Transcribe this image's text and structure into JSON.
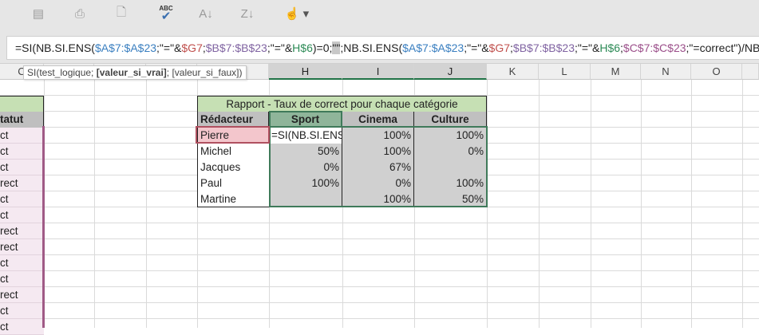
{
  "toolbar": {
    "items": [
      {
        "icon": "form-icon",
        "glyph": "▤"
      },
      {
        "icon": "print-preview-icon",
        "glyph": "⎙"
      },
      {
        "icon": "preview-icon",
        "glyph": "🗋"
      },
      {
        "icon": "spelling-icon",
        "glyph": "✔",
        "label": "ABC"
      },
      {
        "icon": "sort-asc-icon",
        "glyph": "A↓"
      },
      {
        "icon": "sort-desc-icon",
        "glyph": "Z↓"
      },
      {
        "icon": "touch-mode-icon",
        "glyph": "☝"
      }
    ]
  },
  "formula": [
    {
      "t": "=SI(NB.SI.ENS(",
      "c": "#222"
    },
    {
      "t": "$A$7:$A$23",
      "c": "#3a7fc0"
    },
    {
      "t": ";\"=\"&",
      "c": "#222"
    },
    {
      "t": "$G7",
      "c": "#c0504d"
    },
    {
      "t": ";",
      "c": "#222"
    },
    {
      "t": "$B$7:$B$23",
      "c": "#8064a2"
    },
    {
      "t": ";\"=\"&",
      "c": "#222"
    },
    {
      "t": "H$6",
      "c": "#2e8b57"
    },
    {
      "t": ")=0;",
      "c": "#222"
    },
    {
      "t": "\"\"",
      "c": "#222",
      "sel": true
    },
    {
      "t": ";NB.SI.ENS(",
      "c": "#222"
    },
    {
      "t": "$A$7:$A$23",
      "c": "#3a7fc0"
    },
    {
      "t": ";\"=\"&",
      "c": "#222"
    },
    {
      "t": "$G7",
      "c": "#c0504d"
    },
    {
      "t": ";",
      "c": "#222"
    },
    {
      "t": "$B$7:$B$23",
      "c": "#8064a2"
    },
    {
      "t": ";\"=\"&",
      "c": "#222"
    },
    {
      "t": "H$6",
      "c": "#2e8b57"
    },
    {
      "t": ";",
      "c": "#222"
    },
    {
      "t": "$C$7:$C$23",
      "c": "#9b4f8a"
    },
    {
      "t": ";\"=correct\")/NB.SI.ENS(",
      "c": "#222"
    }
  ],
  "tooltip": {
    "prefix": "SI(test_logique; ",
    "bold": "[valeur_si_vrai]",
    "suffix": "; [valeur_si_faux])"
  },
  "columns": [
    "C",
    "H",
    "I",
    "J",
    "K",
    "L",
    "M",
    "N",
    "O"
  ],
  "col_c": {
    "header": "tatut",
    "values": [
      "ct",
      "ct",
      "ct",
      "rect",
      "ct",
      "ct",
      "rect",
      "rect",
      "ct",
      "ct",
      "rect",
      "ct",
      "ct"
    ]
  },
  "report": {
    "title": "Rapport - Taux de correct pour chaque catégorie",
    "headers": [
      "Rédacteur",
      "Sport",
      "Cinema",
      "Culture"
    ],
    "rows": [
      {
        "name": "Pierre",
        "values": [
          "=SI(NB.SI.ENS(",
          "100%",
          "100%"
        ]
      },
      {
        "name": "Michel",
        "values": [
          "50%",
          "100%",
          "0%"
        ]
      },
      {
        "name": "Jacques",
        "values": [
          "0%",
          "67%",
          ""
        ]
      },
      {
        "name": "Paul",
        "values": [
          "100%",
          "0%",
          "100%"
        ]
      },
      {
        "name": "Martine",
        "values": [
          "",
          "100%",
          "50%"
        ]
      }
    ]
  }
}
